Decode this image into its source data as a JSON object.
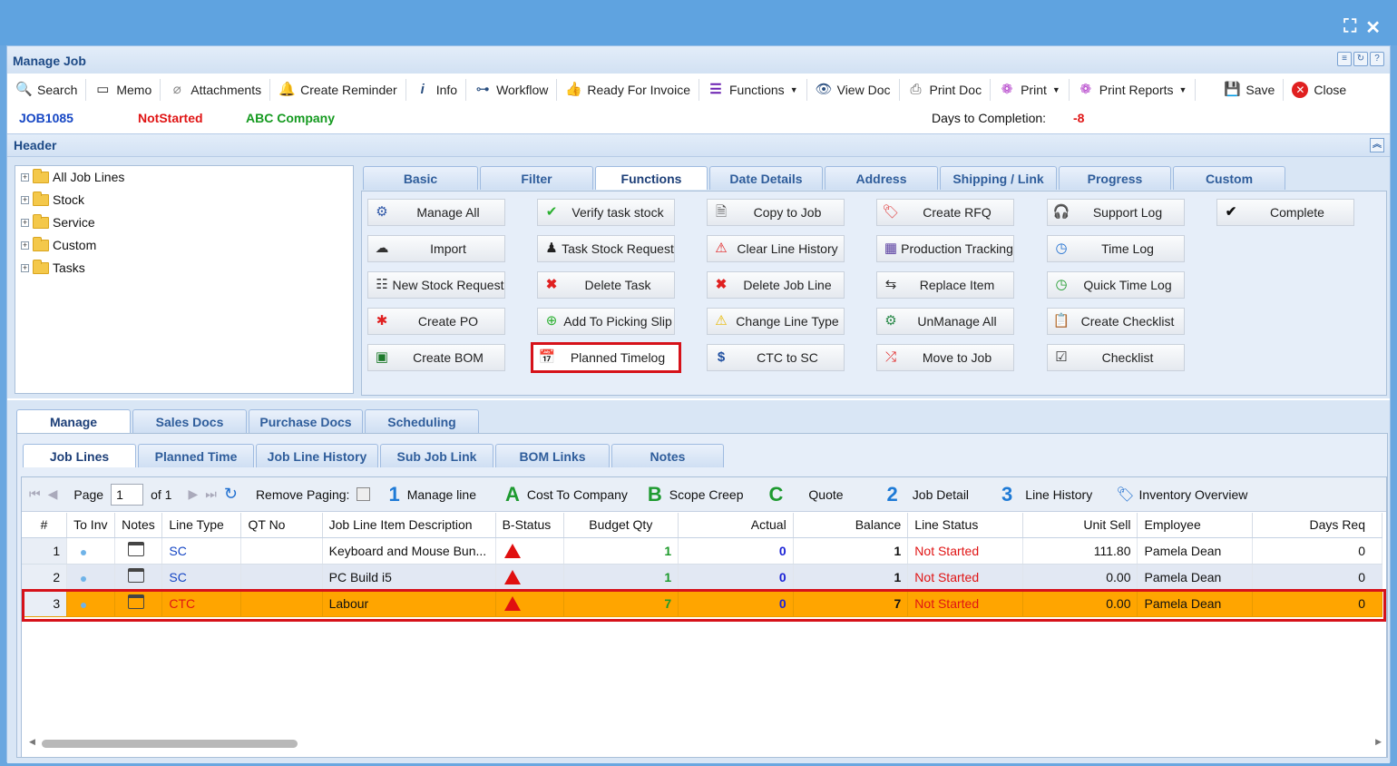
{
  "window": {
    "title": "Manage Job",
    "controls": [
      "expand-icon",
      "close-icon"
    ]
  },
  "toolbar": [
    {
      "label": "Search",
      "icon": "search-icon"
    },
    {
      "label": "Memo",
      "icon": "memo-icon"
    },
    {
      "label": "Attachments",
      "icon": "paperclip-icon"
    },
    {
      "label": "Create Reminder",
      "icon": "bell-icon"
    },
    {
      "label": "Info",
      "icon": "info-icon"
    },
    {
      "label": "Workflow",
      "icon": "workflow-icon"
    },
    {
      "label": "Ready For Invoice",
      "icon": "thumbs-up-icon"
    },
    {
      "label": "Functions",
      "icon": "menu-icon",
      "dropdown": true
    },
    {
      "label": "View Doc",
      "icon": "eye-icon"
    },
    {
      "label": "Print Doc",
      "icon": "printer-icon"
    },
    {
      "label": "Print",
      "icon": "print-circle-icon",
      "dropdown": true
    },
    {
      "label": "Print Reports",
      "icon": "print-reports-icon",
      "dropdown": true
    },
    {
      "label": "Save",
      "icon": "save-icon"
    },
    {
      "label": "Close",
      "icon": "close-circle-icon"
    }
  ],
  "info": {
    "job": "JOB1085",
    "status": "NotStarted",
    "company": "ABC Company",
    "days_label": "Days to Completion:",
    "days_value": "-8"
  },
  "header": {
    "title": "Header"
  },
  "tree": [
    "All Job Lines",
    "Stock",
    "Service",
    "Custom",
    "Tasks"
  ],
  "top_tabs": [
    "Basic",
    "Filter",
    "Functions",
    "Date Details",
    "Address",
    "Shipping / Link",
    "Progress",
    "Custom"
  ],
  "functions": {
    "col1": [
      "Manage All",
      "Import",
      "New Stock Request",
      "Create PO",
      "Create BOM"
    ],
    "col2": [
      "Verify task stock",
      "Task Stock Request",
      "Delete Task",
      "Add To Picking Slip",
      "Planned Timelog"
    ],
    "col3": [
      "Copy to Job",
      "Clear Line History",
      "Delete Job Line",
      "Change Line Type",
      "CTC to SC"
    ],
    "col4": [
      "Create RFQ",
      "Production Tracking",
      "Replace Item",
      "UnManage All",
      "Move to Job"
    ],
    "col5": [
      "Support Log",
      "Time Log",
      "Quick Time Log",
      "Create Checklist",
      "Checklist"
    ],
    "col6": [
      "Complete"
    ]
  },
  "bottom_tabs": [
    "Manage",
    "Sales Docs",
    "Purchase Docs",
    "Scheduling"
  ],
  "sub_tabs": [
    "Job Lines",
    "Planned Time",
    "Job Line History",
    "Sub Job Link",
    "BOM Links",
    "Notes"
  ],
  "pager": {
    "page_label": "Page",
    "page_value": "1",
    "of": "of 1",
    "remove_paging": "Remove Paging:",
    "legend": [
      {
        "key": "1",
        "label": "Manage line"
      },
      {
        "key": "A",
        "label": "Cost To Company"
      },
      {
        "key": "B",
        "label": "Scope Creep"
      },
      {
        "key": "C",
        "label": "Quote"
      },
      {
        "key": "2",
        "label": "Job Detail"
      },
      {
        "key": "3",
        "label": "Line History"
      }
    ],
    "inventory": "Inventory Overview"
  },
  "grid": {
    "columns": [
      "#",
      "To Inv",
      "Notes",
      "Line Type",
      "QT No",
      "Job Line Item Description",
      "B-Status",
      "Budget Qty",
      "Actual",
      "Balance",
      "Line Status",
      "Unit Sell",
      "Employee",
      "Days Req"
    ],
    "rows": [
      {
        "n": "1",
        "type": "SC",
        "qt": "",
        "desc": "Keyboard and Mouse Bun...",
        "budget": "1",
        "actual": "0",
        "balance": "1",
        "status": "Not Started",
        "unit": "111.80",
        "emp": "Pamela Dean",
        "days": "0"
      },
      {
        "n": "2",
        "type": "SC",
        "qt": "",
        "desc": "PC Build i5",
        "budget": "1",
        "actual": "0",
        "balance": "1",
        "status": "Not Started",
        "unit": "0.00",
        "emp": "Pamela Dean",
        "days": "0"
      },
      {
        "n": "3",
        "type": "CTC",
        "qt": "",
        "desc": "Labour",
        "budget": "7",
        "actual": "0",
        "balance": "7",
        "status": "Not Started",
        "unit": "0.00",
        "emp": "Pamela Dean",
        "days": "0"
      }
    ]
  }
}
